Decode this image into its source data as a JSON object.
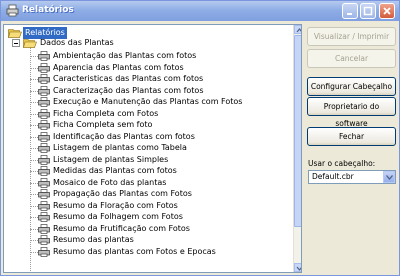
{
  "window": {
    "title": "Relatórios"
  },
  "tree": {
    "root_label": "Relatórios",
    "group_label": "Dados das Plantas",
    "items": [
      "Ambientação das Plantas com fotos",
      "Aparencia das Plantas com fotos",
      "Caracteristicas das Plantas com fotos",
      "Caracterização das Plantas com fotos",
      "Execução e Manutenção das Plantas com Fotos",
      "Ficha Completa com Fotos",
      "Ficha Completa sem foto",
      "Identificação das Plantas com fotos",
      "Listagem de plantas como Tabela",
      "Listagem de plantas Simples",
      "Medidas das Plantas com fotos",
      "Mosaico de Foto das plantas",
      "Propagação das Plantas com Fotos",
      "Resumo da Floração com Fotos",
      "Resumo da Folhagem com Fotos",
      "Resumo da Frutificação com Fotos",
      "Resumo das plantas",
      "Resumo das plantas com Fotos e Epocas"
    ]
  },
  "buttons": {
    "view_print": "Visualizar / Imprimir",
    "cancel": "Cancelar",
    "configure_header": "Configurar Cabeçalho",
    "software_owner": "Proprietario do software",
    "close": "Fechar"
  },
  "header_select": {
    "label": "Usar o cabeçalho:",
    "value": "Default.cbr"
  }
}
